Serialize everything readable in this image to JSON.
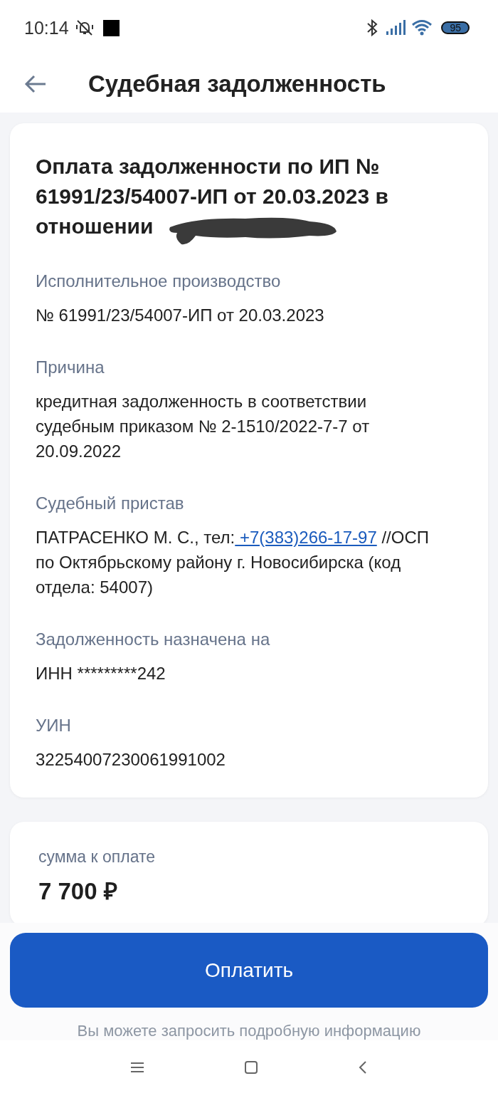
{
  "status_bar": {
    "time": "10:14",
    "battery": "95"
  },
  "header": {
    "title": "Судебная задолженность"
  },
  "debt_card": {
    "title": "Оплата задолженности по ИП № 61991/23/54007-ИП от 20.03.2023 в отношении",
    "redacted": true,
    "fields": [
      {
        "kind": "text",
        "label": "Исполнительное производство",
        "value": "№ 61991/23/54007-ИП от 20.03.2023"
      },
      {
        "kind": "text",
        "label": "Причина",
        "value": "кредитная задолженность в соответствии судебным приказом № 2-1510/2022-7-7 от 20.09.2022"
      },
      {
        "kind": "link",
        "label": "Судебный пристав",
        "value": "ПАТРАСЕНКО М. С., тел:",
        "link": " +7(383)266-17-97",
        "value_after": "//ОСП по Октябрьскому району г. Новосибирска (код отдела: 54007)"
      },
      {
        "kind": "text",
        "label": "Задолженность назначена на",
        "value": "ИНН *********242"
      },
      {
        "kind": "text",
        "label": "УИН",
        "value": "32254007230061991002"
      }
    ]
  },
  "amount_card": {
    "label": "сумма к оплате",
    "amount": "7 700 ₽"
  },
  "pay_button": "Оплатить",
  "footer_note": "Вы можете запросить подробную информацию"
}
